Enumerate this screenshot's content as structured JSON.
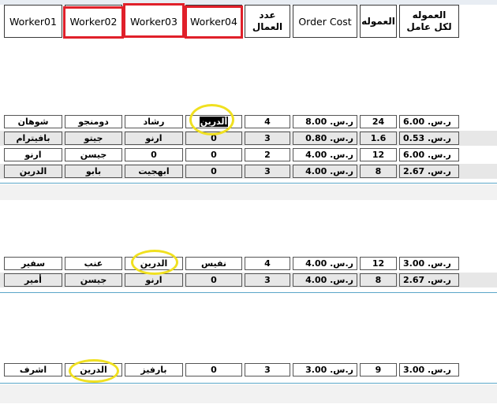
{
  "header": {
    "w01": "Worker01",
    "w02": "Worker02",
    "w03": "Worker03",
    "w04": "Worker04",
    "workers_count": "عدد العمال",
    "order_cost": "Order Cost",
    "commission": "العموله",
    "commission_per_worker": "العموله لكل عامل"
  },
  "colors": {
    "annotation_box": "#e0202a",
    "annotation_circle": "#f0e020",
    "selected_cell": "#000000"
  },
  "group1": [
    {
      "w01": "شوهان",
      "w02": "دومنجو",
      "w03": "رشاد",
      "w04": "ألدرين",
      "count": "4",
      "cost": "ر.س. 8.00",
      "comm": "24",
      "per": "ر.س. 6.00"
    },
    {
      "w01": "بافيترام",
      "w02": "جيتو",
      "w03": "ارنو",
      "w04": "0",
      "count": "3",
      "cost": "ر.س. 0.80",
      "comm": "1.6",
      "per": "ر.س. 0.53"
    },
    {
      "w01": "ارنو",
      "w02": "جيسن",
      "w03": "0",
      "w04": "0",
      "count": "2",
      "cost": "ر.س. 4.00",
      "comm": "12",
      "per": "ر.س. 6.00"
    },
    {
      "w01": "الدرين",
      "w02": "بابو",
      "w03": "ابهجيت",
      "w04": "0",
      "count": "3",
      "cost": "ر.س. 4.00",
      "comm": "8",
      "per": "ر.س. 2.67"
    }
  ],
  "group2": [
    {
      "w01": "سفير",
      "w02": "عنب",
      "w03": "الدرين",
      "w04": "نفيس",
      "count": "4",
      "cost": "ر.س. 4.00",
      "comm": "12",
      "per": "ر.س. 3.00"
    },
    {
      "w01": "أمير",
      "w02": "جيسن",
      "w03": "ارنو",
      "w04": "0",
      "count": "3",
      "cost": "ر.س. 4.00",
      "comm": "8",
      "per": "ر.س. 2.67"
    }
  ],
  "group3": [
    {
      "w01": "اشرف",
      "w02": "الدرين",
      "w03": "بارفيز",
      "w04": "0",
      "count": "3",
      "cost": "ر.س. 3.00",
      "comm": "9",
      "per": "ر.س. 3.00"
    }
  ]
}
